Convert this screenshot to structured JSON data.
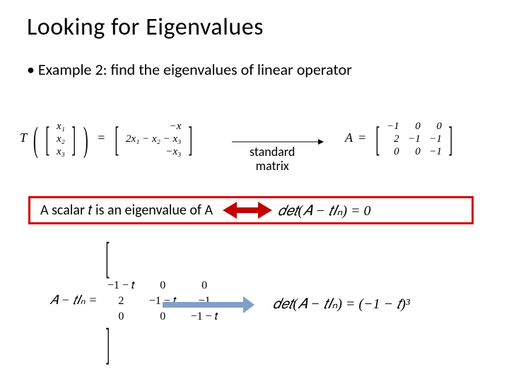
{
  "title": "Looking for Eigenvalues",
  "bullet": "• Example 2: find the eigenvalues of linear operator",
  "operator": {
    "T": "T",
    "vec": {
      "x1": "x₁",
      "x2": "x₂",
      "x3": "x₃"
    },
    "result": {
      "r1": "−x",
      "r2": "2x₁ − x₂ − x₃",
      "r3": "−x₃"
    }
  },
  "std_label": "standard\nmatrix",
  "matrixA": {
    "label": "A",
    "eq": "=",
    "rows": [
      [
        "−1",
        "0",
        "0"
      ],
      [
        "2",
        "−1",
        "−1"
      ],
      [
        "0",
        "0",
        "−1"
      ]
    ]
  },
  "redbox": {
    "left": "A scalar 𝑡 is an eigenvalue of A",
    "right": "𝑑𝑒𝑡(𝐴 − 𝑡𝐼ₙ) = 0"
  },
  "AtI": {
    "lhs": "𝐴 − 𝑡𝐼ₙ =",
    "rows": [
      [
        "−1 − 𝑡",
        "0",
        "0"
      ],
      [
        "2",
        "−1 − 𝑡",
        "−1"
      ],
      [
        "0",
        "0",
        "−1 − 𝑡"
      ]
    ]
  },
  "result": "𝑑𝑒𝑡(𝐴 − 𝑡𝐼ₙ) = (−1 − 𝑡)³"
}
